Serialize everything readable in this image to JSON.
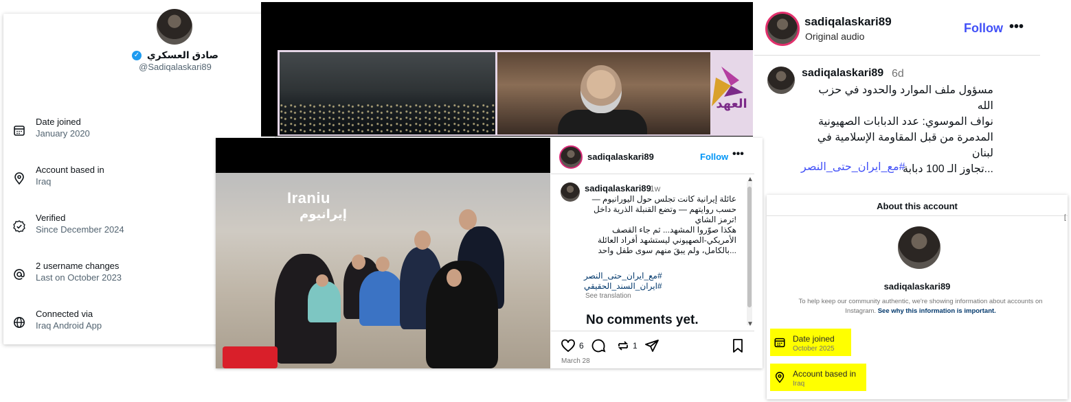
{
  "x_profile": {
    "name": "صادق العسكري",
    "verified_icon": "verified-badge-icon",
    "handle": "@Sadiqalaskari89",
    "rows": [
      {
        "icon": "calendar-icon",
        "label": "Date joined",
        "value": "January 2020"
      },
      {
        "icon": "location-pin-icon",
        "label": "Account based in",
        "value": "Iraq"
      },
      {
        "icon": "verified-check-icon",
        "label": "Verified",
        "value": "Since December 2024"
      },
      {
        "icon": "at-sign-icon",
        "label": "2 username changes",
        "value": "Last on October 2023"
      },
      {
        "icon": "globe-icon",
        "label": "Connected via",
        "value": "Iraq Android App"
      }
    ]
  },
  "video": {
    "channel_logo_text": "العهد"
  },
  "post": {
    "watermark_en": "Iraniu",
    "watermark_ar": "إيرانيوم",
    "username": "sadiqalaskari89",
    "follow_label": "Follow",
    "more_label": "•••",
    "comment": {
      "username": "sadiqalaskari89",
      "time": "1w",
      "text_lines": [
        "عائلة إيرانية كانت تجلس حول اليورانيوم —",
        "حسب روايتهم — وتضع القنبلة الذرية داخل",
        "!ترمز الشاي",
        "هكذا صوّروا المشهد... ثم جاء القصف",
        "الأمريكي-الصهيوني ليستشهد أفراد العائلة",
        "...بالكامل، ولم يبقَ منهم سوى طفل واحد"
      ],
      "tags": [
        "#مع_ايران_حتى_النصر",
        "#ايران_السند_الحقيقي"
      ],
      "see_translation": "See translation"
    },
    "no_comments": "No comments yet.",
    "likes": "6",
    "reposts": "1",
    "date": "March 28"
  },
  "reel": {
    "username": "sadiqalaskari89",
    "audio": "Original audio",
    "follow_label": "Follow",
    "more_label": "•••",
    "caption_user": "sadiqalaskari89",
    "caption_time": "6d",
    "caption_lines": [
      "مسؤول ملف الموارد والحدود في حزب الله",
      "نواف الموسوي: عدد الدبابات الصهيونية",
      "المدمرة من قبل المقاومة الإسلامية في لبنان",
      "...تجاوز الـ 100 دبابة"
    ],
    "caption_tag": "#مع_ايران_حتى_النصر"
  },
  "about": {
    "title": "About this account",
    "username": "sadiqalaskari89",
    "info_text": "To help keep our community authentic, we're showing information about accounts on Instagram.",
    "info_link": "See why this information is important.",
    "date_joined_label": "Date joined",
    "date_joined_value": "October 2025",
    "based_label": "Account based in",
    "based_value": "Iraq",
    "highlight_color": "#ffff00"
  },
  "colors": {
    "x_blue": "#1d9bf0",
    "ig_link": "#4150f7",
    "ig_follow": "#0095f6"
  }
}
